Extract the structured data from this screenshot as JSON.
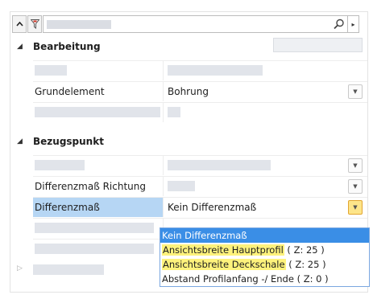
{
  "search": {
    "placeholder": ""
  },
  "sections": {
    "bearbeitung": {
      "label": "Bearbeitung"
    },
    "bezugspunkt": {
      "label": "Bezugspunkt"
    }
  },
  "rows": {
    "grundelement": {
      "label": "Grundelement",
      "value": "Bohrung"
    },
    "diff_richtung": {
      "label": "Differenzmaß Richtung"
    },
    "differenzmass": {
      "label": "Differenzmaß",
      "value": "Kein Differenzmaß"
    }
  },
  "dropdown": {
    "options": [
      {
        "label": "Kein Differenzmaß",
        "suffix": ""
      },
      {
        "label": "Ansichtsbreite Hauptprofil",
        "suffix": " ( Z: 25 )"
      },
      {
        "label": "Ansichtsbreite Deckschale",
        "suffix": " ( Z: 25 )"
      },
      {
        "label": "Abstand Profilanfang -/ Ende",
        "suffix": " ( Z: 0 )"
      }
    ]
  },
  "colors": {
    "selected_row": "#b6d6f4",
    "selected_option": "#3a8ee6",
    "highlight": "#fef27c",
    "active_dropdown_button": "#fde58a"
  }
}
